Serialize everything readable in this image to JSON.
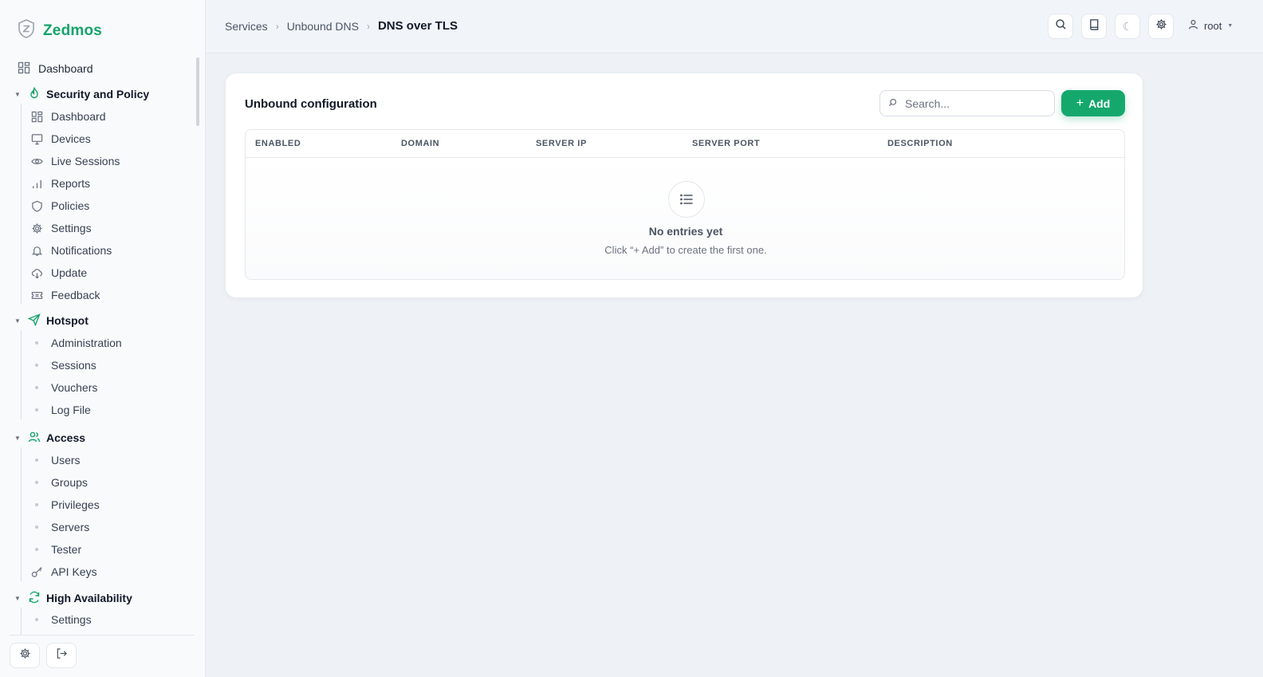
{
  "brand": {
    "name": "Zedmos"
  },
  "sidebar": {
    "top_item": {
      "label": "Dashboard",
      "icon": "grid-icon"
    },
    "groups": [
      {
        "title": "Security and Policy",
        "icon": "flame-icon",
        "items": [
          {
            "label": "Dashboard",
            "icon": "grid-icon"
          },
          {
            "label": "Devices",
            "icon": "monitor-icon"
          },
          {
            "label": "Live Sessions",
            "icon": "eye-icon"
          },
          {
            "label": "Reports",
            "icon": "bar-chart-icon"
          },
          {
            "label": "Policies",
            "icon": "shield-icon"
          },
          {
            "label": "Settings",
            "icon": "gear-icon"
          },
          {
            "label": "Notifications",
            "icon": "bell-icon"
          },
          {
            "label": "Update",
            "icon": "cloud-download-icon"
          },
          {
            "label": "Feedback",
            "icon": "ticket-icon"
          }
        ]
      },
      {
        "title": "Hotspot",
        "icon": "send-icon",
        "items": [
          {
            "label": "Administration"
          },
          {
            "label": "Sessions"
          },
          {
            "label": "Vouchers"
          },
          {
            "label": "Log File"
          }
        ]
      },
      {
        "title": "Access",
        "icon": "users-icon",
        "items": [
          {
            "label": "Users"
          },
          {
            "label": "Groups"
          },
          {
            "label": "Privileges"
          },
          {
            "label": "Servers"
          },
          {
            "label": "Tester"
          },
          {
            "label": "API Keys",
            "icon": "key-icon"
          }
        ]
      },
      {
        "title": "High Availability",
        "icon": "refresh-icon",
        "items": [
          {
            "label": "Settings"
          }
        ]
      }
    ],
    "bottom_buttons": [
      "gear-icon",
      "logout-icon"
    ]
  },
  "header": {
    "breadcrumbs": [
      "Services",
      "Unbound DNS",
      "DNS over TLS"
    ],
    "buttons": [
      "search-icon",
      "book-icon",
      "moon-icon",
      "gear-icon"
    ],
    "user": "root"
  },
  "main": {
    "card_title": "Unbound configuration",
    "search_placeholder": "Search...",
    "add_label": "Add",
    "columns": [
      "ENABLED",
      "DOMAIN",
      "SERVER IP",
      "SERVER PORT",
      "DESCRIPTION"
    ],
    "empty_title": "No entries yet",
    "empty_subtitle": "Click “+ Add” to create the first one."
  },
  "colors": {
    "accent": "#15a86d",
    "brand": "#16a36a"
  }
}
